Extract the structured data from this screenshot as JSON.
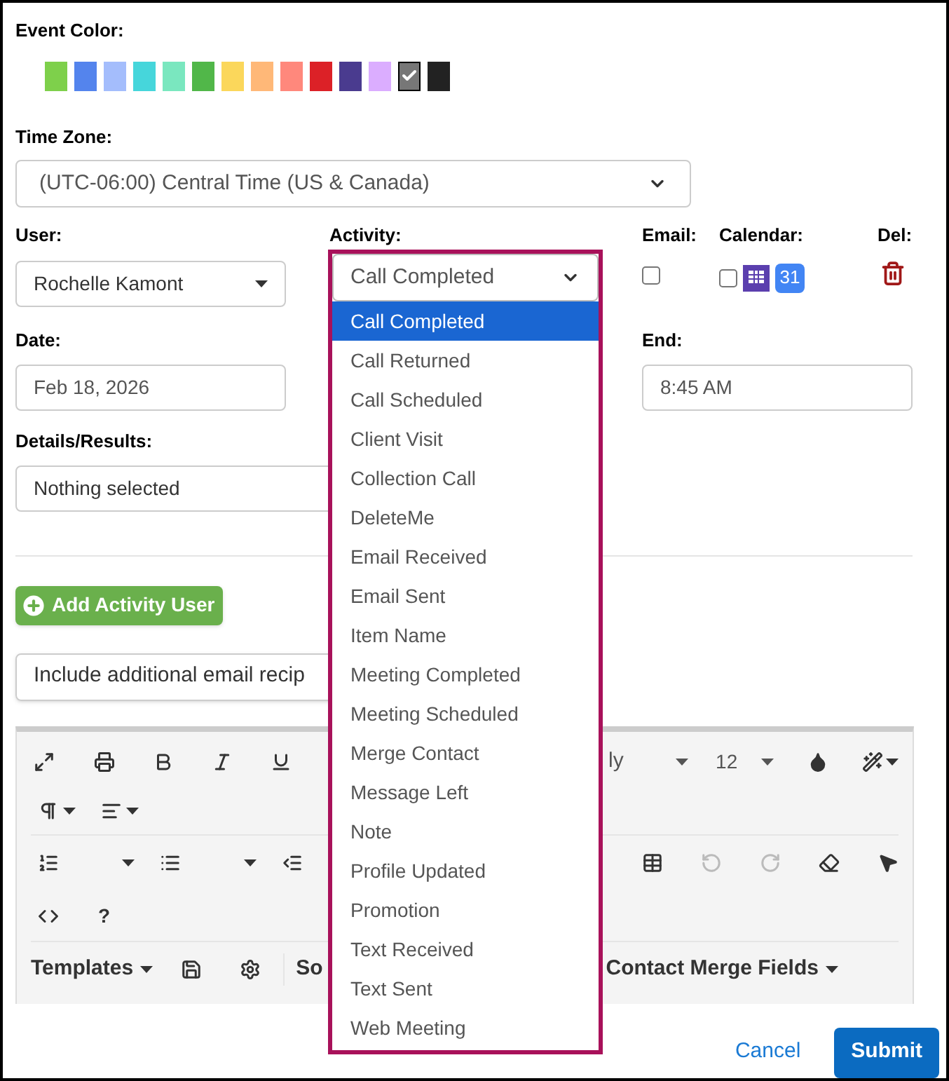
{
  "event_color": {
    "label": "Event Color:",
    "swatches": [
      {
        "color": "#7ed04b",
        "selected": false
      },
      {
        "color": "#5484ed",
        "selected": false
      },
      {
        "color": "#a4bdfc",
        "selected": false
      },
      {
        "color": "#46d6db",
        "selected": false
      },
      {
        "color": "#7ae7bf",
        "selected": false
      },
      {
        "color": "#51b749",
        "selected": false
      },
      {
        "color": "#fbd75b",
        "selected": false
      },
      {
        "color": "#ffb878",
        "selected": false
      },
      {
        "color": "#ff887c",
        "selected": false
      },
      {
        "color": "#dc2127",
        "selected": false
      },
      {
        "color": "#4a3b8f",
        "selected": false
      },
      {
        "color": "#dbadff",
        "selected": false
      },
      {
        "color": "#777777",
        "selected": true
      },
      {
        "color": "#222222",
        "selected": false
      }
    ]
  },
  "time_zone": {
    "label": "Time Zone:",
    "value": "(UTC-06:00) Central Time (US & Canada)"
  },
  "user": {
    "label": "User:",
    "value": "Rochelle Kamont"
  },
  "activity": {
    "label": "Activity:",
    "value": "Call Completed",
    "options": [
      {
        "label": "Call Completed",
        "selected": true
      },
      {
        "label": "Call Returned",
        "selected": false
      },
      {
        "label": "Call Scheduled",
        "selected": false
      },
      {
        "label": "Client Visit",
        "selected": false
      },
      {
        "label": "Collection Call",
        "selected": false
      },
      {
        "label": "DeleteMe",
        "selected": false
      },
      {
        "label": "Email Received",
        "selected": false
      },
      {
        "label": "Email Sent",
        "selected": false
      },
      {
        "label": "Item Name",
        "selected": false
      },
      {
        "label": "Meeting Completed",
        "selected": false
      },
      {
        "label": "Meeting Scheduled",
        "selected": false
      },
      {
        "label": "Merge Contact",
        "selected": false
      },
      {
        "label": "Message Left",
        "selected": false
      },
      {
        "label": "Note",
        "selected": false
      },
      {
        "label": "Profile Updated",
        "selected": false
      },
      {
        "label": "Promotion",
        "selected": false
      },
      {
        "label": "Text Received",
        "selected": false
      },
      {
        "label": "Text Sent",
        "selected": false
      },
      {
        "label": "Web Meeting",
        "selected": false
      }
    ]
  },
  "email": {
    "label": "Email:",
    "checked": false
  },
  "calendar": {
    "label": "Calendar:",
    "checked": false,
    "google_day": "31"
  },
  "delete": {
    "label": "Del:"
  },
  "date": {
    "label": "Date:",
    "value": "Feb 18, 2026"
  },
  "end": {
    "label": "End:",
    "value": "8:45 AM"
  },
  "details": {
    "label": "Details/Results:",
    "value": "Nothing selected"
  },
  "add_user_button": "Add Activity User",
  "email_recipients": {
    "value": "Include additional email recip"
  },
  "editor": {
    "font_family": "ly",
    "font_size": "12",
    "help": "?",
    "undo": {
      "disabled": true
    },
    "redo": {
      "disabled": true
    },
    "templates": "Templates",
    "menu_2": "So",
    "merge_fields": "Contact Merge Fields"
  },
  "actions": {
    "cancel": "Cancel",
    "submit": "Submit"
  }
}
